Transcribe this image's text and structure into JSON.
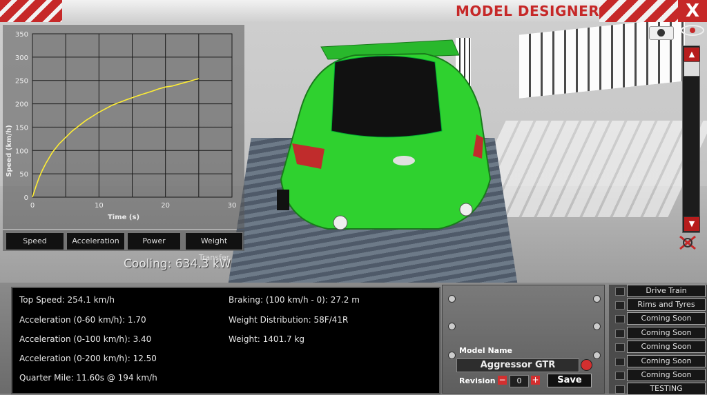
{
  "window": {
    "title": "MODEL DESIGNER",
    "close_label": "X"
  },
  "graph": {
    "chart_data": {
      "type": "line",
      "xlabel": "Time (s)",
      "ylabel": "Speed (km/h)",
      "xlim": [
        0,
        30
      ],
      "ylim": [
        0,
        350
      ],
      "xticks": [
        0,
        10,
        20,
        30
      ],
      "yticks": [
        0,
        50,
        100,
        150,
        200,
        250,
        300,
        350
      ],
      "grid": true,
      "series": [
        {
          "color": "#ffee33",
          "x": [
            0,
            0.5,
            1,
            1.5,
            2,
            3,
            4,
            5,
            6,
            8,
            10,
            12,
            14,
            16,
            18,
            19,
            20,
            21,
            22,
            23,
            24,
            25
          ],
          "y": [
            0,
            22,
            42,
            58,
            72,
            96,
            114,
            128,
            142,
            164,
            182,
            197,
            208,
            218,
            227,
            232,
            236,
            238,
            242,
            246,
            250,
            254
          ]
        }
      ]
    },
    "tabs": [
      "Speed",
      "Acceleration",
      "Power",
      "Weight Transfer"
    ]
  },
  "cooling": "Cooling: 634.3 kW",
  "stats": {
    "top_speed": "Top Speed: 254.1 km/h",
    "accel_60": "Acceleration (0-60 km/h): 1.70",
    "accel_100": "Acceleration (0-100 km/h): 3.40",
    "accel_200": "Acceleration (0-200 km/h): 12.50",
    "quarter_mile": "Quarter Mile: 11.60s @ 194 km/h",
    "braking": "Braking: (100 km/h - 0): 27.2 m",
    "weight_dist": "Weight Distribution: 58F/41R",
    "weight": "Weight: 1401.7 kg"
  },
  "model": {
    "name_label": "Model Name",
    "name_value": "Aggressor GTR",
    "revision_label": "Revision",
    "revision_value": "0",
    "minus": "−",
    "plus": "+",
    "save_label": "Save"
  },
  "side_tabs": [
    "Drive Train",
    "Rims and Tyres",
    "Coming Soon",
    "Coming Soon",
    "Coming Soon",
    "Coming Soon",
    "Coming Soon",
    "TESTING"
  ],
  "scroll": {
    "up": "▲",
    "down": "▼"
  },
  "colors": {
    "accent_red": "#c62828",
    "car_green": "#2ecc2e",
    "curve_yellow": "#ffee33"
  },
  "icons": [
    "camera-icon",
    "eye-icon",
    "no-draw-icon",
    "randomize-icon"
  ]
}
